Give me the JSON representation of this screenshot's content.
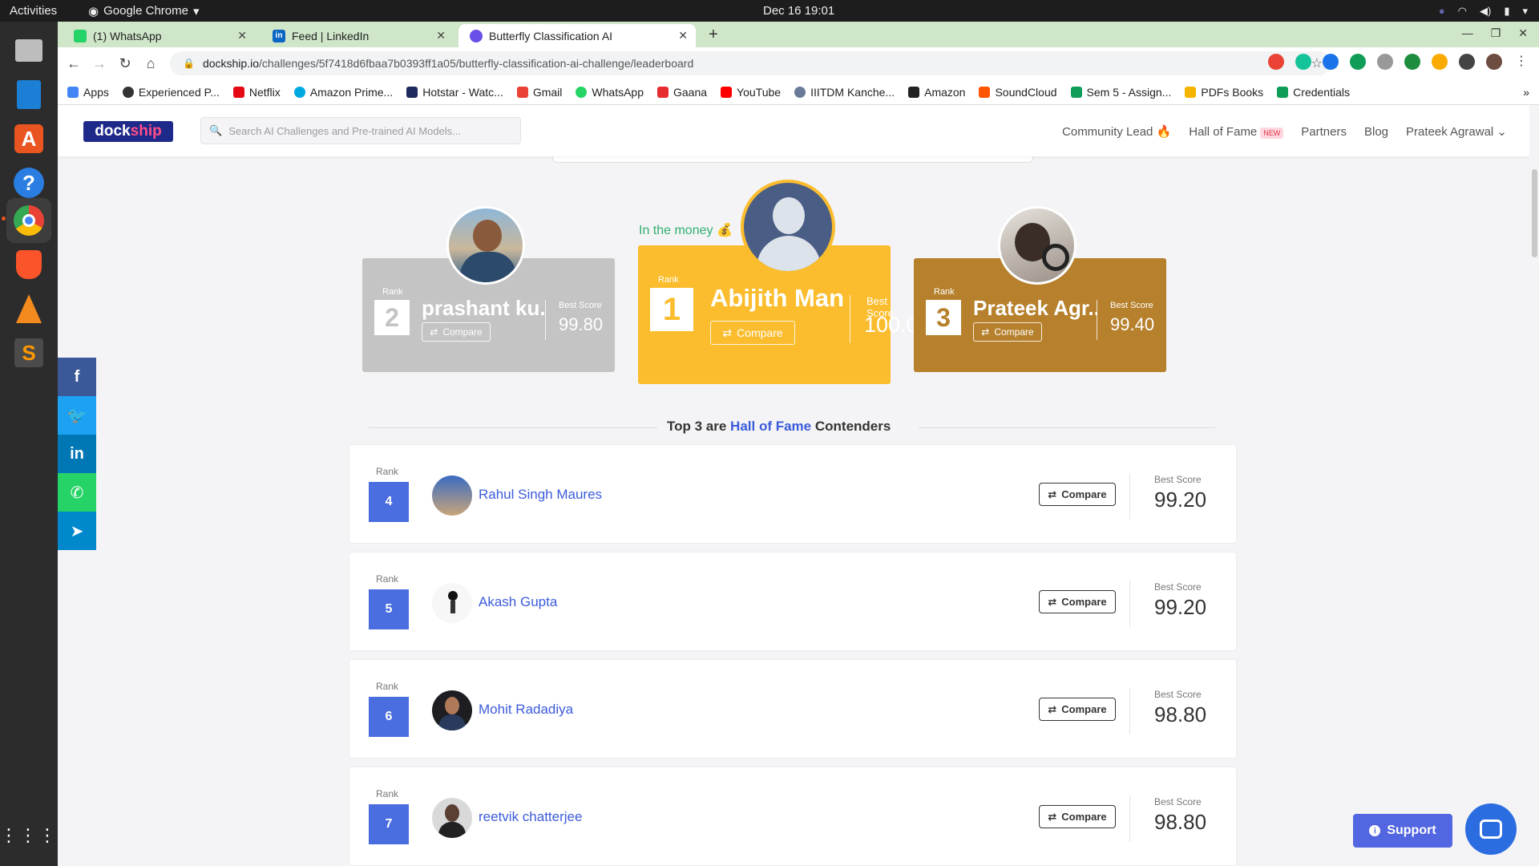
{
  "os": {
    "activities": "Activities",
    "app_name": "Google Chrome",
    "clock": "Dec 16  19:01"
  },
  "browser": {
    "tabs": [
      {
        "label": "(1) WhatsApp",
        "color": "#25d366"
      },
      {
        "label": "Feed | LinkedIn",
        "color": "#0a66c2"
      },
      {
        "label": "Butterfly Classification AI",
        "color": "#6b4ee6"
      }
    ],
    "url_host": "dockship.io",
    "url_path": "/challenges/5f7418d6fbaa7b0393ff1a05/butterfly-classification-ai-challenge/leaderboard",
    "bookmarks": [
      {
        "label": "Apps",
        "color": "#4285f4"
      },
      {
        "label": "Experienced P...",
        "color": "#333333"
      },
      {
        "label": "Netflix",
        "color": "#e50914"
      },
      {
        "label": "Amazon Prime...",
        "color": "#00a8e1"
      },
      {
        "label": "Hotstar - Watc...",
        "color": "#1f2a5c"
      },
      {
        "label": "Gmail",
        "color": "#ea4335"
      },
      {
        "label": "WhatsApp",
        "color": "#25d366"
      },
      {
        "label": "Gaana",
        "color": "#e72c30"
      },
      {
        "label": "YouTube",
        "color": "#ff0000"
      },
      {
        "label": "IIITDM Kanche...",
        "color": "#6b7a99"
      },
      {
        "label": "Amazon",
        "color": "#222222"
      },
      {
        "label": "SoundCloud",
        "color": "#ff5500"
      },
      {
        "label": "Sem 5 - Assign...",
        "color": "#0f9d58"
      },
      {
        "label": "PDFs Books",
        "color": "#f4b400"
      },
      {
        "label": "Credentials",
        "color": "#0f9d58"
      }
    ]
  },
  "site": {
    "logo_a": "dock",
    "logo_b": "ship",
    "search_placeholder": "Search AI Challenges and Pre-trained AI Models...",
    "nav": {
      "community": "Community Lead 🔥",
      "hall_of_fame": "Hall of Fame",
      "new_badge": "NEW",
      "partners": "Partners",
      "blog": "Blog",
      "user": "Prateek Agrawal"
    }
  },
  "podium": {
    "money_label": "In the money 💰",
    "rank_label": "Rank",
    "best_score_label": "Best Score",
    "compare_label": "Compare",
    "first": {
      "rank": "1",
      "name": "Abijith Man...",
      "score": "100.00"
    },
    "second": {
      "rank": "2",
      "name": "prashant ku...",
      "score": "99.80"
    },
    "third": {
      "rank": "3",
      "name": "Prateek Agr...",
      "score": "99.40"
    }
  },
  "divider": {
    "prefix": "Top 3 are ",
    "highlight": "Hall of Fame",
    "suffix": " Contenders"
  },
  "leaderboard": {
    "rank_label": "Rank",
    "best_score_label": "Best Score",
    "compare_label": "Compare",
    "rows": [
      {
        "rank": "4",
        "name": "Rahul Singh Maures",
        "score": "99.20"
      },
      {
        "rank": "5",
        "name": "Akash Gupta",
        "score": "99.20"
      },
      {
        "rank": "6",
        "name": "Mohit Radadiya",
        "score": "98.80"
      },
      {
        "rank": "7",
        "name": "reetvik chatterjee",
        "score": "98.80"
      }
    ]
  },
  "support": {
    "label": "Support"
  },
  "colors": {
    "gold": "#fbbd2d",
    "silver": "#c4c4c4",
    "bronze": "#b6802c",
    "rank_blue": "#4a6ee0",
    "link_blue": "#3b5bdb"
  }
}
